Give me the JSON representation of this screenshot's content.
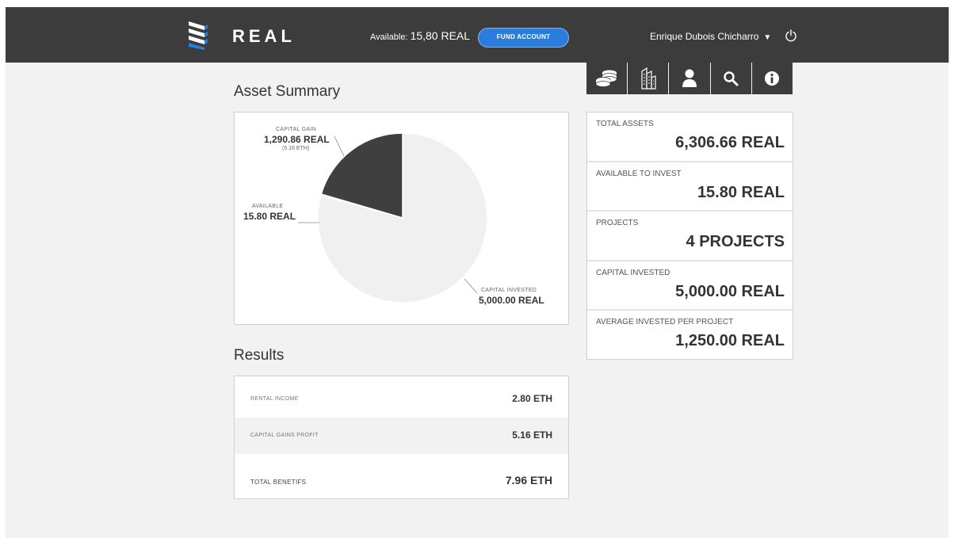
{
  "header": {
    "brand": "REAL",
    "available_label": "Available:",
    "available_amount": "15,80 REAL",
    "fund_button": "FUND ACCOUNT",
    "user_name": "Enrique Dubois Chicharro"
  },
  "toolbar": {
    "items": [
      "coins-icon",
      "buildings-icon",
      "user-icon",
      "search-icon",
      "info-icon"
    ]
  },
  "asset_summary": {
    "title": "Asset Summary",
    "capital_gain_label": "CAPITAL GAIN",
    "capital_gain_value": "1,290.86 REAL",
    "capital_gain_sub": "(5.16 ETH)",
    "available_label": "AVAILABLE",
    "available_value": "15.80 REAL",
    "capital_invested_label": "CAPITAL INVESTED",
    "capital_invested_value": "5,000.00 REAL"
  },
  "chart_data": {
    "type": "pie",
    "slices": [
      {
        "label": "CAPITAL INVESTED",
        "value": 5000.0,
        "color": "#f0f0f0"
      },
      {
        "label": "AVAILABLE",
        "value": 15.8,
        "color": "#6e6e6e"
      },
      {
        "label": "CAPITAL GAIN",
        "value": 1290.86,
        "color": "#3f3f3f"
      }
    ]
  },
  "stats": [
    {
      "label": "TOTAL ASSETS",
      "value": "6,306.66 REAL"
    },
    {
      "label": "AVAILABLE TO INVEST",
      "value": "15.80 REAL"
    },
    {
      "label": "PROJECTS",
      "value": "4 PROJECTS"
    },
    {
      "label": "CAPITAL INVESTED",
      "value": "5,000.00 REAL"
    },
    {
      "label": "AVERAGE INVESTED PER PROJECT",
      "value": "1,250.00 REAL"
    }
  ],
  "results": {
    "title": "Results",
    "rows": [
      {
        "label": "RENTAL INCOME",
        "value": "2.80 ETH"
      },
      {
        "label": "CAPITAL GAINS PROFIT",
        "value": "5.16 ETH"
      },
      {
        "label": "TOTAL BENETIFS",
        "value": "7.96 ETH"
      }
    ]
  },
  "colors": {
    "header_bg": "#3c3c3c",
    "accent_blue": "#2a7ddb",
    "page_bg": "#f2f2f2"
  }
}
